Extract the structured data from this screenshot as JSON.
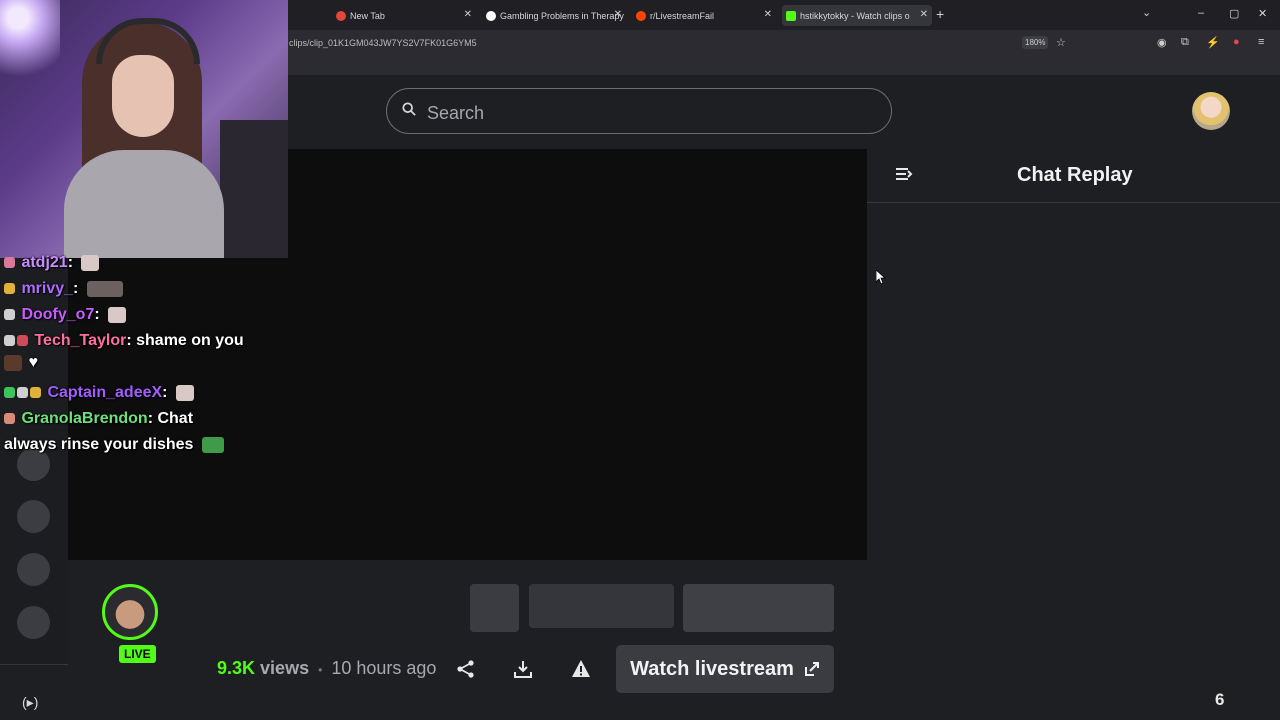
{
  "browser": {
    "tabs": [
      {
        "title": "New Tab",
        "favicon_color": "#e2463a"
      },
      {
        "title": "Gambling Problems in Therapy",
        "favicon_color": "#ffffff"
      },
      {
        "title": "r/LivestreamFail",
        "favicon_color": "#ff4500"
      },
      {
        "title": "hstikkytokky - Watch clips on K",
        "favicon_color": "#53fc18",
        "active": true
      }
    ],
    "url": "clips/clip_01K1GM043JW7YS2V7FK01G6YM5",
    "zoom": "180%",
    "window_controls": [
      "–",
      "▢",
      "✕"
    ]
  },
  "site": {
    "search_placeholder": "Search"
  },
  "chat_panel": {
    "title": "Chat Replay"
  },
  "chat_overlay": {
    "messages": [
      {
        "user": "atdj21",
        "user_color": "#c98cff",
        "text": ""
      },
      {
        "user": "mrivy_",
        "user_color": "#b06bff",
        "text": ""
      },
      {
        "user": "Doofy_o7",
        "user_color": "#c95cff",
        "text": ""
      },
      {
        "user": "Tech_Taylor",
        "user_color": "#ff6fa0",
        "text": "shame on you"
      },
      {
        "user": "Captain_adeeX",
        "user_color": "#a35cff",
        "text": ""
      },
      {
        "user": "GranolaBrendon",
        "user_color": "#6fe07a",
        "text": "Chat"
      },
      {
        "user": "",
        "user_color": "#ffffff",
        "text": "always rinse your dishes"
      }
    ]
  },
  "clip": {
    "live_badge": "LIVE",
    "views": "9.3K",
    "views_label": "views",
    "separator": "•",
    "age": "10 hours ago",
    "watch_button": "Watch livestream",
    "page_number": "6"
  },
  "colors": {
    "brand_green": "#53fc18",
    "page_bg": "#1e1f22",
    "video_bg": "#0d0d0e"
  }
}
